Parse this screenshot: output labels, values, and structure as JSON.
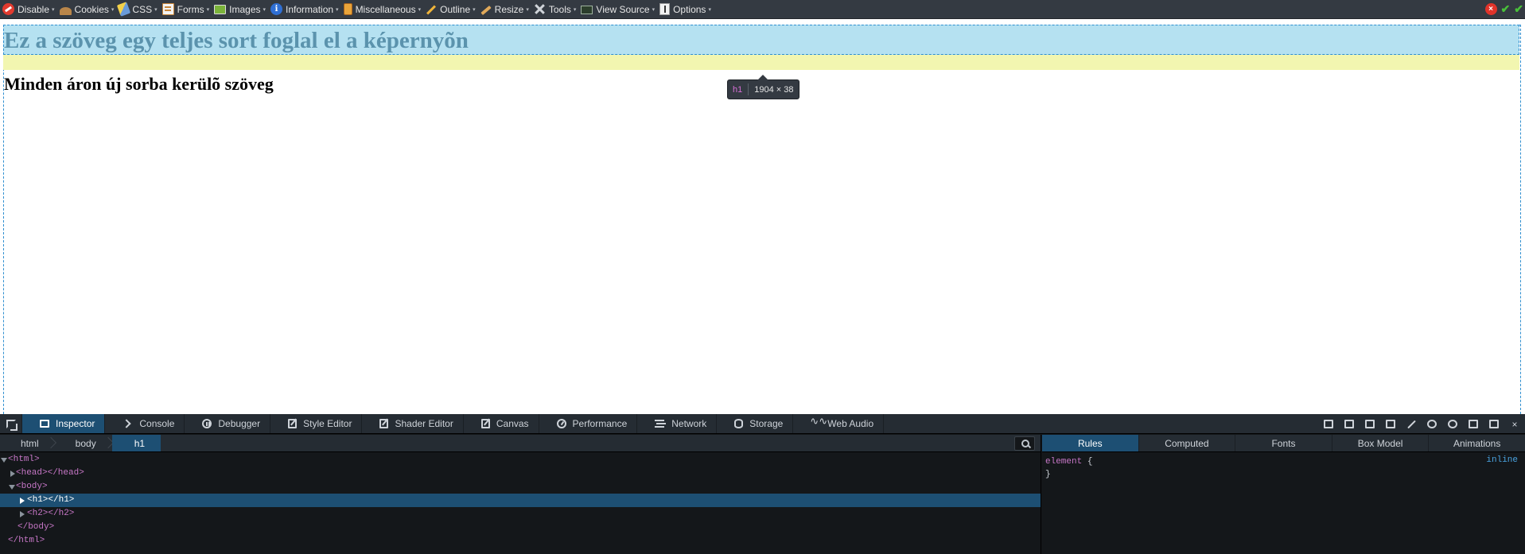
{
  "toolbar": {
    "items": [
      {
        "label": "Disable",
        "icon": "disable-icon"
      },
      {
        "label": "Cookies",
        "icon": "cookie-icon"
      },
      {
        "label": "CSS",
        "icon": "css-icon"
      },
      {
        "label": "Forms",
        "icon": "forms-icon"
      },
      {
        "label": "Images",
        "icon": "images-icon"
      },
      {
        "label": "Information",
        "icon": "information-icon"
      },
      {
        "label": "Miscellaneous",
        "icon": "miscellaneous-icon"
      },
      {
        "label": "Outline",
        "icon": "outline-icon"
      },
      {
        "label": "Resize",
        "icon": "resize-icon"
      },
      {
        "label": "Tools",
        "icon": "tools-icon"
      },
      {
        "label": "View Source",
        "icon": "view-source-icon"
      },
      {
        "label": "Options",
        "icon": "options-icon"
      }
    ],
    "caret": "▾",
    "close_glyph": "×",
    "check_glyph": "✔"
  },
  "page": {
    "h1": "Ez a szöveg egy teljes sort foglal el a képernyõn",
    "h2": "Minden áron új sorba kerülõ szöveg"
  },
  "highlighter": {
    "tag": "h1",
    "dimensions": "1904 × 38"
  },
  "devtools": {
    "tabs": [
      {
        "label": "Inspector",
        "icon": "inspector-icon",
        "active": true
      },
      {
        "label": "Console",
        "icon": "console-icon"
      },
      {
        "label": "Debugger",
        "icon": "debugger-icon"
      },
      {
        "label": "Style Editor",
        "icon": "style-editor-icon"
      },
      {
        "label": "Shader Editor",
        "icon": "shader-editor-icon"
      },
      {
        "label": "Canvas",
        "icon": "canvas-icon"
      },
      {
        "label": "Performance",
        "icon": "performance-icon"
      },
      {
        "label": "Network",
        "icon": "network-icon"
      },
      {
        "label": "Storage",
        "icon": "storage-icon"
      },
      {
        "label": "Web Audio",
        "icon": "web-audio-icon"
      }
    ],
    "breadcrumbs": [
      "html",
      "body",
      "h1"
    ],
    "tree": [
      {
        "text": "<html>",
        "twisty": "open"
      },
      {
        "text": "<head></head>",
        "twisty": "closed"
      },
      {
        "text": "<body>",
        "twisty": "open"
      },
      {
        "text": "<h1></h1>",
        "twisty": "closed",
        "selected": true
      },
      {
        "text": "<h2></h2>",
        "twisty": "closed"
      },
      {
        "text": "</body>",
        "twisty": "none"
      },
      {
        "text": "</html>",
        "twisty": "none"
      }
    ],
    "side_tabs": [
      "Rules",
      "Computed",
      "Fonts",
      "Box Model",
      "Animations"
    ],
    "rules": {
      "selector": "element",
      "open_brace": "{",
      "close_brace": "}",
      "source": "inline"
    }
  },
  "colors": {
    "toolbar_bg": "#343a42",
    "h1_highlight": "#b5e1f1",
    "margin_highlight": "#f2f6b0",
    "h1_text": "#5b93ad",
    "devtools_bg": "#14171a",
    "devtools_active": "#1d4f73",
    "tag_color": "#c777c7"
  }
}
